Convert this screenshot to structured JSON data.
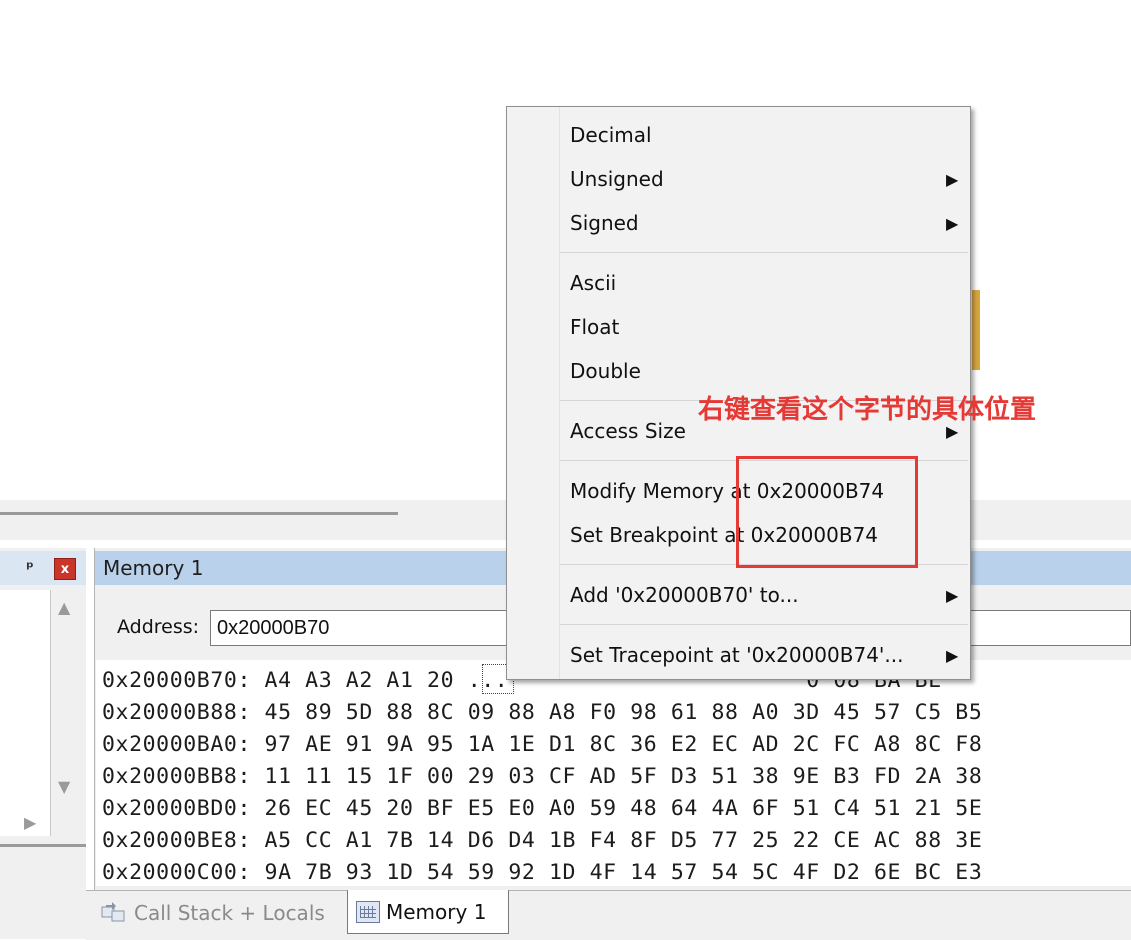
{
  "left_pane": {
    "pin_icon": "pin-icon",
    "close_glyph": "x"
  },
  "memory_window": {
    "title": "Memory 1",
    "address_label": "Address:",
    "address_value": "0x20000B70",
    "rows": [
      "0x20000B70: A4 A3 A2 A1 20 ...                      0 08 BA BE",
      "0x20000B88: 45 89 5D 88 8C 09 88 A8 F0 98 61 88 A0 3D 45 57 C5 B5",
      "0x20000BA0: 97 AE 91 9A 95 1A 1E D1 8C 36 E2 EC AD 2C FC A8 8C F8",
      "0x20000BB8: 11 11 15 1F 00 29 03 CF AD 5F D3 51 38 9E B3 FD 2A 38",
      "0x20000BD0: 26 EC 45 20 BF E5 E0 A0 59 48 64 4A 6F 51 C4 51 21 5E",
      "0x20000BE8: A5 CC A1 7B 14 D6 D4 1B F4 8F D5 77 25 22 CE AC 88 3E",
      "0x20000C00: 9A 7B 93 1D 54 59 92 1D 4F 14 57 54 5C 4F D2 6E BC E3"
    ]
  },
  "tabs": [
    {
      "label": "Call Stack + Locals",
      "active": false
    },
    {
      "label": "Memory 1",
      "active": true
    }
  ],
  "context_menu": {
    "items": {
      "decimal": "Decimal",
      "unsigned": "Unsigned",
      "signed": "Signed",
      "ascii": "Ascii",
      "float": "Float",
      "double": "Double",
      "access_size": "Access Size",
      "modify_memory": "Modify Memory at 0x20000B74",
      "set_breakpoint": "Set Breakpoint at 0x20000B74",
      "add_to": "Add '0x20000B70' to...",
      "set_tracepoint": "Set Tracepoint at '0x20000B74'..."
    },
    "submenu_glyph": "▶"
  },
  "annotation": {
    "text": "右键查看这个字节的具体位置",
    "color": "#e53935"
  },
  "colors": {
    "title_bar_active": "#b9d1ea",
    "close_button": "#c9352b",
    "annotation_red": "#e53935"
  }
}
